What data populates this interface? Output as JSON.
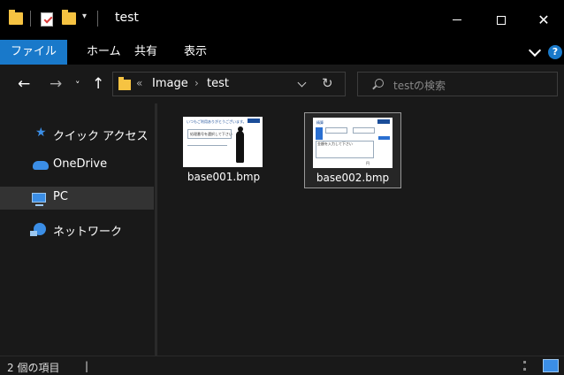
{
  "window": {
    "title": "test"
  },
  "ribbon": {
    "tabs": [
      "ファイル",
      "ホーム",
      "共有",
      "表示"
    ],
    "help": "?"
  },
  "nav": {
    "back": "←",
    "forward": "→",
    "recent": "˅",
    "up": "↑",
    "breadcrumb": {
      "overflow": "«",
      "items": [
        "Image",
        "test"
      ],
      "separator": "›"
    },
    "refresh": "↻",
    "search_placeholder": "testの検索"
  },
  "sidebar": {
    "items": [
      {
        "label": "クイック アクセス",
        "icon": "star-icon"
      },
      {
        "label": "OneDrive",
        "icon": "cloud-icon"
      },
      {
        "label": "PC",
        "icon": "pc-icon",
        "selected": true
      },
      {
        "label": "ネットワーク",
        "icon": "network-icon"
      }
    ]
  },
  "files": [
    {
      "name": "base001.bmp",
      "thumb": {
        "header": "いつもご利用ありがとうございます。",
        "text": "処理番号を選択して下さい"
      }
    },
    {
      "name": "base002.bmp",
      "selected": true,
      "thumb": {
        "header": "精算",
        "text": "金額を入力して下さい",
        "unit": "円"
      }
    }
  ],
  "status": {
    "count_text": "2 個の項目",
    "separator": "|"
  },
  "colors": {
    "accent": "#1979ca",
    "folder": "#f6c342",
    "background": "#191919",
    "titlebar": "#000000"
  }
}
